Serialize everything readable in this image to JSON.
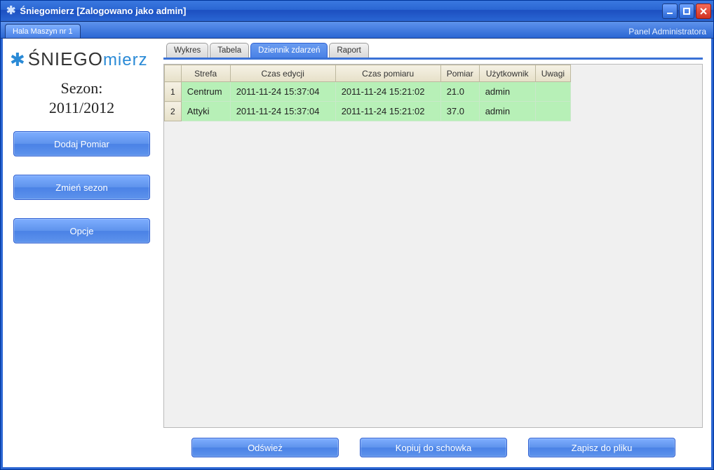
{
  "window": {
    "title": "Śniegomierz [Zalogowano jako admin]"
  },
  "bar2": {
    "tab": "Hala Maszyn nr 1",
    "admin_link": "Panel Administratora"
  },
  "logo": {
    "part1": "ŚNIEGO",
    "part2": "mierz"
  },
  "season": {
    "label": "Sezon:",
    "value": "2011/2012"
  },
  "sidebar": {
    "add": "Dodaj Pomiar",
    "change": "Zmień sezon",
    "options": "Opcje"
  },
  "tabs": {
    "wykres": "Wykres",
    "tabela": "Tabela",
    "dziennik": "Dziennik zdarzeń",
    "raport": "Raport"
  },
  "grid": {
    "headers": {
      "strefa": "Strefa",
      "czas_edycji": "Czas edycji",
      "czas_pomiaru": "Czas pomiaru",
      "pomiar": "Pomiar",
      "uzytkownik": "Użytkownik",
      "uwagi": "Uwagi"
    },
    "rows": [
      {
        "n": "1",
        "strefa": "Centrum",
        "czas_edycji": "2011-11-24 15:37:04",
        "czas_pomiaru": "2011-11-24 15:21:02",
        "pomiar": "21.0",
        "uzytkownik": "admin",
        "uwagi": ""
      },
      {
        "n": "2",
        "strefa": "Attyki",
        "czas_edycji": "2011-11-24 15:37:04",
        "czas_pomiaru": "2011-11-24 15:21:02",
        "pomiar": "37.0",
        "uzytkownik": "admin",
        "uwagi": ""
      }
    ]
  },
  "bottom": {
    "refresh": "Odśwież",
    "copy": "Kopiuj do schowka",
    "save": "Zapisz do pliku"
  }
}
